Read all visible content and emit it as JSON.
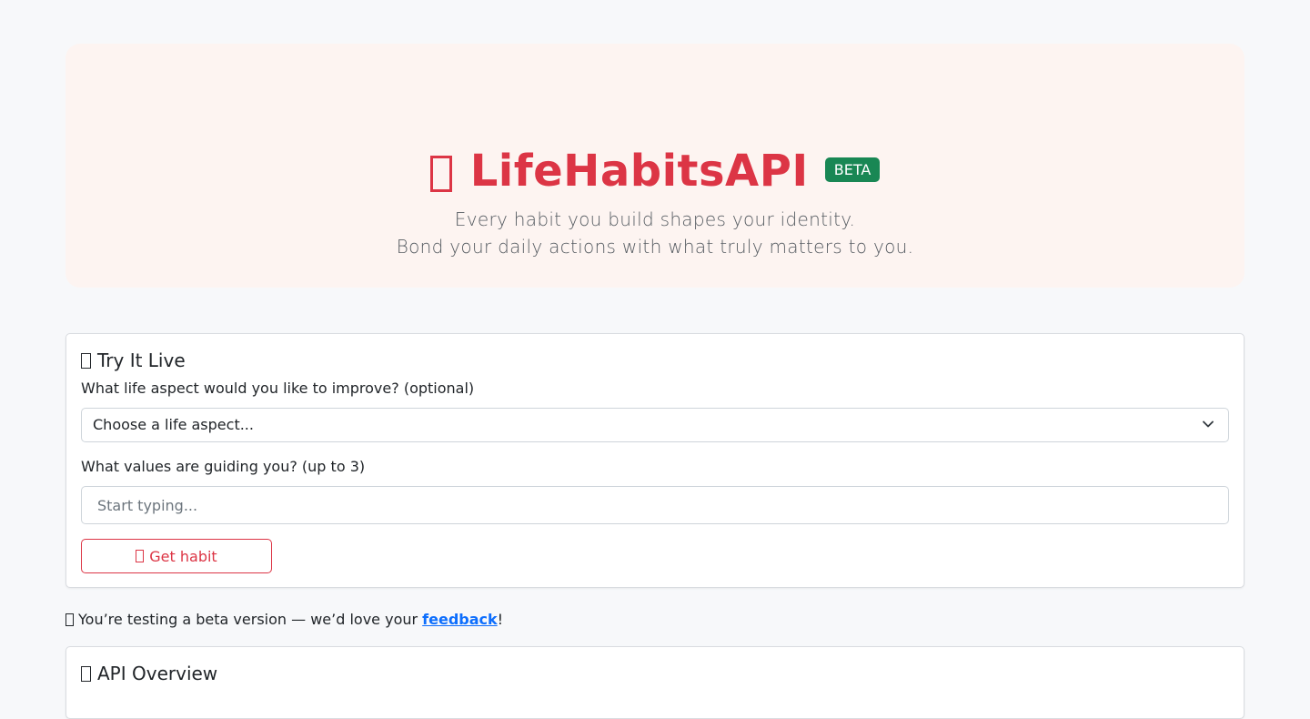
{
  "hero": {
    "icon": "glyph-placeholder-icon",
    "title": "LifeHabitsAPI",
    "badge": "BETA",
    "subtitle_line1": "Every habit you build shapes your identity.",
    "subtitle_line2": "Bond your daily actions with what truly matters to you."
  },
  "try_it": {
    "heading": "Try It Live",
    "aspect_label": "What life aspect would you like to improve? (optional)",
    "aspect_selected": "Choose a life aspect...",
    "values_label": "What values are guiding you? (up to 3)",
    "values_placeholder": "Start typing...",
    "button_label": "Get habit"
  },
  "beta_note": {
    "text_before": "You’re testing a beta version — we’d love your",
    "link_text": "feedback",
    "text_after": "!"
  },
  "api_overview": {
    "heading": "API Overview"
  },
  "colors": {
    "brand": "#dc3545",
    "badge": "#198754",
    "link": "#0d6efd",
    "hero_background": "#fdf4f1",
    "page_background": "#f7f8fa"
  }
}
